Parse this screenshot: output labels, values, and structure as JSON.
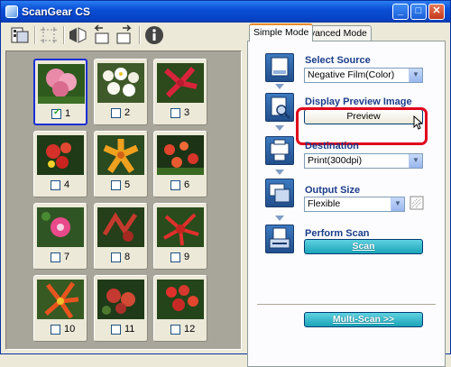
{
  "window": {
    "title": "ScanGear CS",
    "controls": {
      "minimize": "_",
      "maximize": "□",
      "close": "✕"
    }
  },
  "toolbar": {
    "icons": [
      "thumbnail-view-icon",
      "crop-icon",
      "mirror-icon",
      "rotate-left-icon",
      "rotate-right-icon",
      "info-icon"
    ]
  },
  "thumbnails": [
    {
      "number": "1",
      "checked": true,
      "selected": true
    },
    {
      "number": "2",
      "checked": false
    },
    {
      "number": "3",
      "checked": false
    },
    {
      "number": "4",
      "checked": false
    },
    {
      "number": "5",
      "checked": false
    },
    {
      "number": "6",
      "checked": false
    },
    {
      "number": "7",
      "checked": false
    },
    {
      "number": "8",
      "checked": false
    },
    {
      "number": "9",
      "checked": false
    },
    {
      "number": "10",
      "checked": false
    },
    {
      "number": "11",
      "checked": false
    },
    {
      "number": "12",
      "checked": false
    }
  ],
  "tabs": {
    "simple": "Simple Mode",
    "advanced": "Advanced Mode"
  },
  "steps": {
    "select_source": {
      "label": "Select Source",
      "value": "Negative Film(Color)"
    },
    "preview": {
      "label": "Display Preview Image",
      "button": "Preview"
    },
    "destination": {
      "label": "Destination",
      "value": "Print(300dpi)"
    },
    "output_size": {
      "label": "Output Size",
      "value": "Flexible"
    },
    "perform_scan": {
      "label": "Perform Scan",
      "button": "Scan"
    }
  },
  "multi_scan": {
    "button": "Multi-Scan >>"
  },
  "colors": {
    "highlight": "#e0001a",
    "accent_teal": "#1aa4b8",
    "label_blue": "#1b3d8a"
  }
}
